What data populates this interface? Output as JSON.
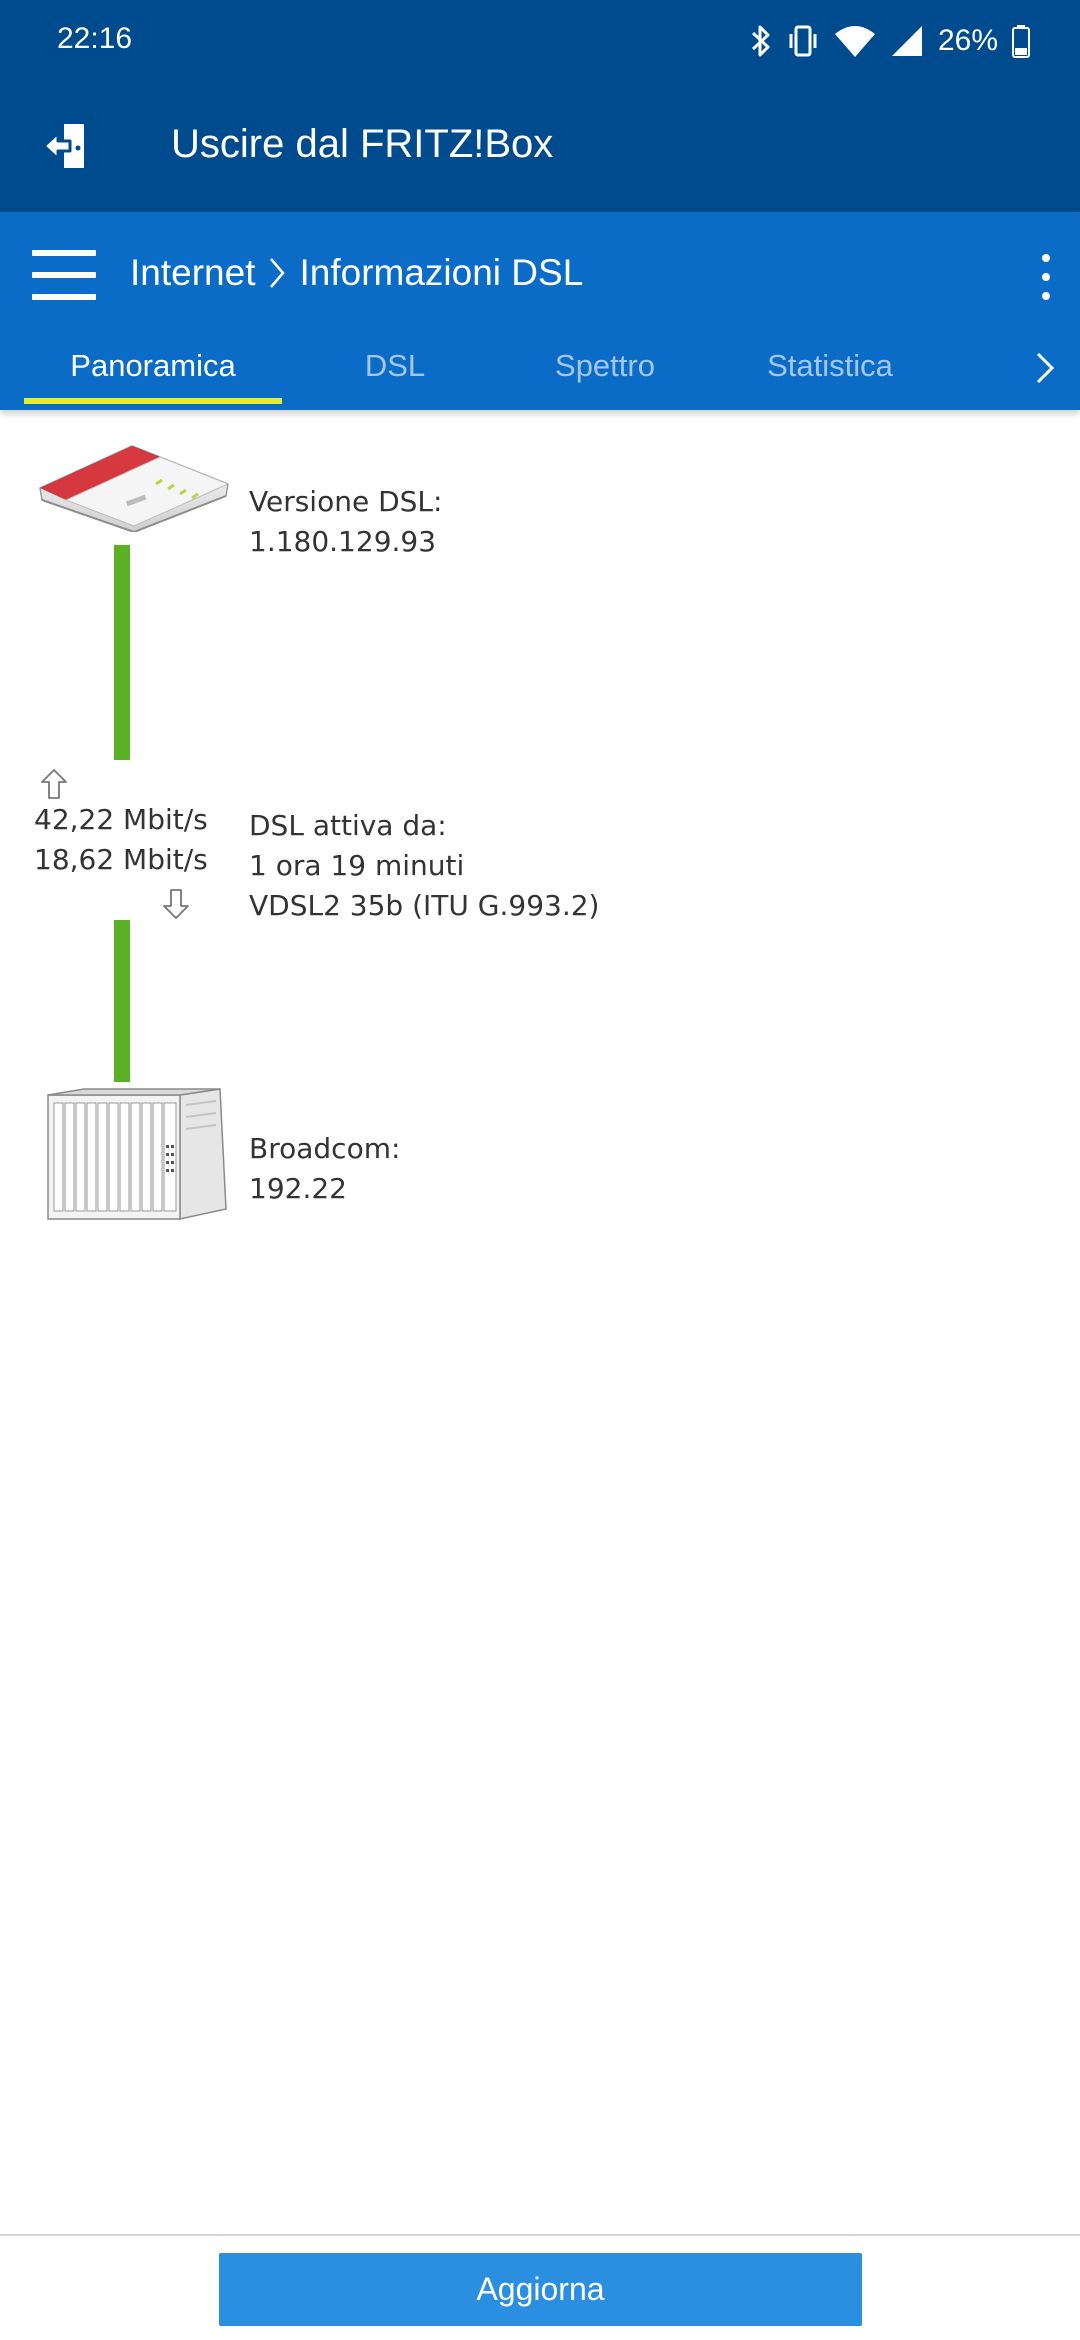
{
  "status_bar": {
    "time": "22:16",
    "battery_percent": "26%",
    "icons": [
      "bluetooth-icon",
      "vibrate-icon",
      "wifi-icon",
      "signal-icon",
      "battery-icon"
    ]
  },
  "header": {
    "title": "Uscire dal FRITZ!Box",
    "exit_icon": "logout-icon"
  },
  "toolbar": {
    "breadcrumb": [
      "Internet",
      "Informazioni DSL"
    ],
    "menu_icon": "hamburger-menu-icon",
    "more_icon": "more-vert-icon"
  },
  "tabs": [
    {
      "label": "Panoramica",
      "active": true
    },
    {
      "label": "DSL",
      "active": false
    },
    {
      "label": "Spettro",
      "active": false
    },
    {
      "label": "Statistica",
      "active": false
    }
  ],
  "overview": {
    "dsl_version_label": "Versione DSL:",
    "dsl_version_value": "1.180.129.93",
    "upstream": "42,22 Mbit/s",
    "downstream": "18,62 Mbit/s",
    "active_since_label": "DSL attiva da:",
    "active_since_value": "1 ora 19 minuti",
    "mode": "VDSL2 35b (ITU G.993.2)",
    "dslam_label": "Broadcom:",
    "dslam_value": "192.22"
  },
  "footer": {
    "refresh_label": "Aggiorna"
  },
  "colors": {
    "header_bg": "#004b8d",
    "toolbar_bg": "#0b6cc7",
    "tab_indicator": "#e5ef3a",
    "line_green": "#5cb024",
    "button_bg": "#2a8fe0"
  }
}
